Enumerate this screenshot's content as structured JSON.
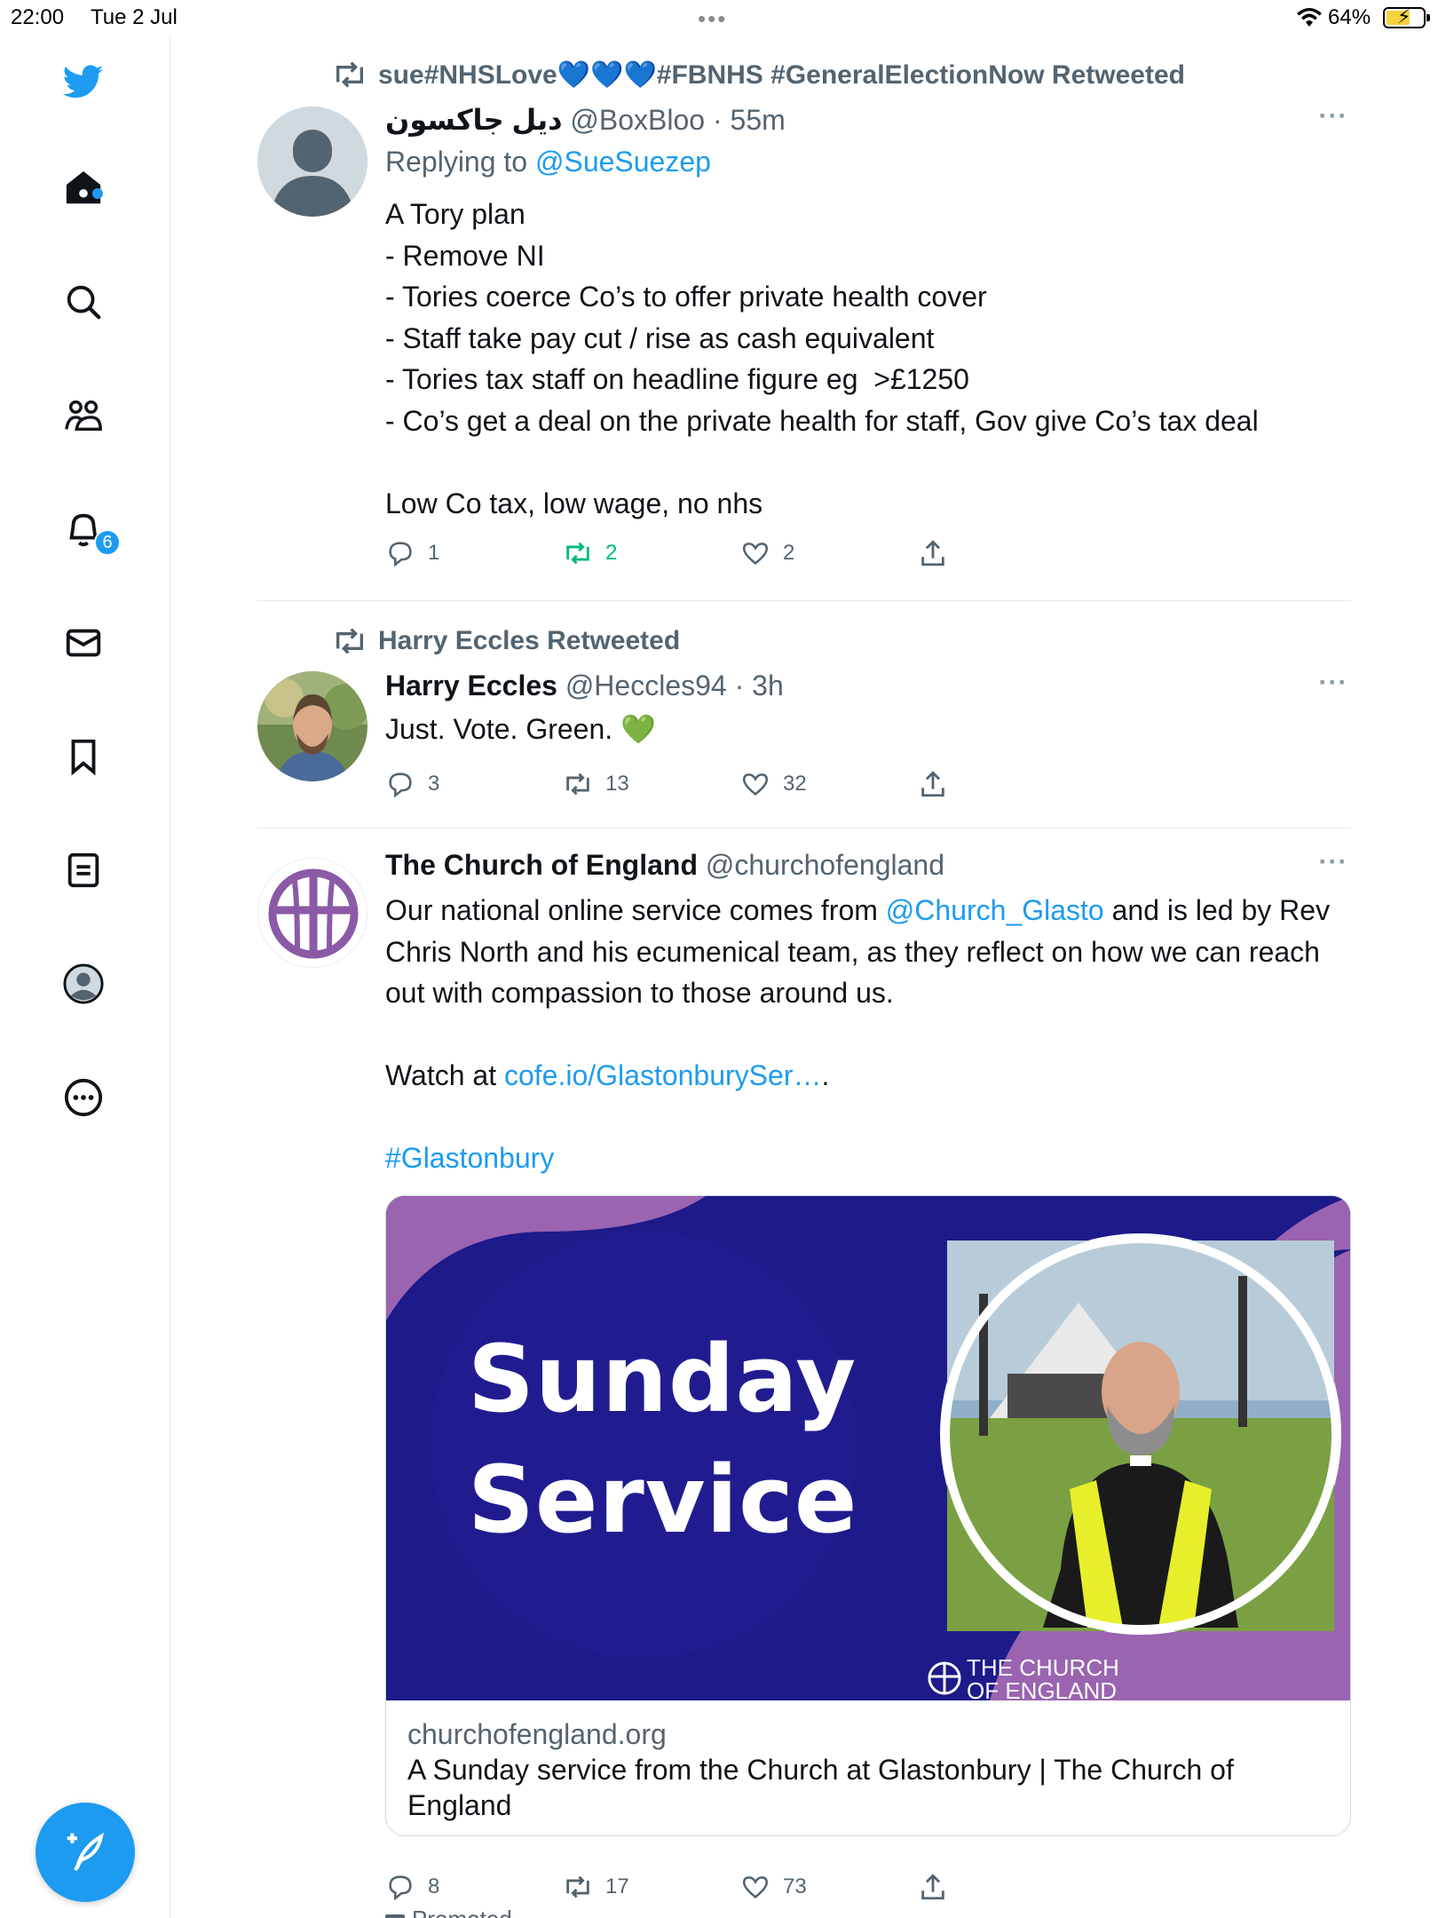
{
  "status_bar": {
    "time": "22:00",
    "date": "Tue 2 Jul",
    "dots": "•••",
    "battery": "64%"
  },
  "sidebar": {
    "items": [
      {
        "name": "home",
        "icon": "home-icon"
      },
      {
        "name": "explore",
        "icon": "search-icon"
      },
      {
        "name": "communities",
        "icon": "people-icon"
      },
      {
        "name": "notifications",
        "icon": "bell-icon"
      },
      {
        "name": "messages",
        "icon": "mail-icon"
      },
      {
        "name": "bookmarks",
        "icon": "bookmark-icon"
      },
      {
        "name": "lists",
        "icon": "list-icon"
      },
      {
        "name": "profile",
        "icon": "avatar-icon"
      },
      {
        "name": "more",
        "icon": "more-circle-icon"
      }
    ],
    "notification_count": "6",
    "compose_icon": "compose-tweet-icon"
  },
  "tweets": [
    {
      "retweeted_by": "sue#NHSLove💙💙💙#FBNHS #GeneralElectionNow Retweeted",
      "name": "ديل جاكسون",
      "handle": "@BoxBloo",
      "time": "· 55m",
      "replying_prefix": "Replying to ",
      "replying_to": "@SueSuezep",
      "text": "A Tory plan\n- Remove NI\n- Tories coerce Co’s to offer private health cover\n- Staff take pay cut / rise as cash equivalent\n- Tories tax staff on headline figure eg  >£1250\n- Co’s get a deal on the private health for staff, Gov give Co’s tax deal\n\nLow Co tax, low wage, no nhs",
      "replies": "1",
      "retweets": "2",
      "likes": "2"
    },
    {
      "retweeted_by": "Harry Eccles Retweeted",
      "name": "Harry Eccles",
      "handle": "@Heccles94",
      "time": "· 3h",
      "text": "Just. Vote. Green. 💚",
      "replies": "3",
      "retweets": "13",
      "likes": "32"
    },
    {
      "name": "The Church of England",
      "handle": "@churchofengland",
      "text_part1": "Our national online service comes from ",
      "mention": "@Church_Glasto",
      "text_part2": " and is led by Rev Chris North and his ecumenical team, as they reflect on how we can reach out with compassion to those around us.\n\nWatch at ",
      "url": "cofe.io/GlastonburySer…",
      "text_part3": ".",
      "hashtag": "#Glastonbury",
      "card": {
        "headline_line1": "Sunday",
        "headline_line2": "Service",
        "logo_text_line1": "THE CHURCH",
        "logo_text_line2": "OF ENGLAND",
        "domain": "churchofengland.org",
        "title": "A Sunday service from the Church at Glastonbury | The Church of England"
      },
      "replies": "8",
      "retweets": "17",
      "likes": "73",
      "next_label": "Promoted"
    }
  ],
  "colors": {
    "accent": "#1d9bf0",
    "retweet_active": "#00ba7c",
    "muted": "#536471",
    "card_navy": "#1d1a8a",
    "card_purple": "#9a64b0"
  }
}
